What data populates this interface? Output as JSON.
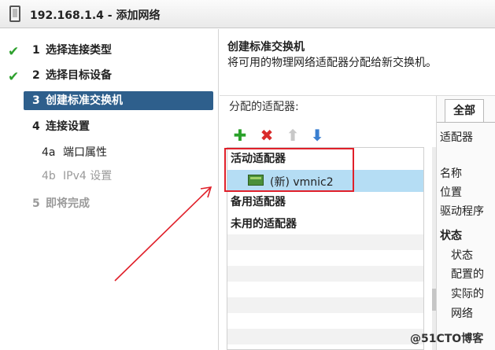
{
  "window": {
    "title": "192.168.1.4 - 添加网络"
  },
  "steps": [
    {
      "num": "1",
      "label": "选择连接类型"
    },
    {
      "num": "2",
      "label": "选择目标设备"
    },
    {
      "num": "3",
      "label": "创建标准交换机"
    },
    {
      "num": "4",
      "label": "连接设置"
    },
    {
      "num": "4a",
      "label": "端口属性"
    },
    {
      "num": "4b",
      "label": "IPv4 设置"
    },
    {
      "num": "5",
      "label": "即将完成"
    }
  ],
  "main": {
    "title": "创建标准交换机",
    "description": "将可用的物理网络适配器分配给新交换机。",
    "assigned_label": "分配的适配器:",
    "groups": {
      "active": "活动适配器",
      "standby": "备用适配器",
      "unused": "未用的适配器"
    },
    "adapter": "(新) vmnic2"
  },
  "right_pane": {
    "tab": "全部",
    "adapter_label": "适配器",
    "name_label": "名称",
    "location_label": "位置",
    "driver_label": "驱动程序",
    "status_heading": "状态",
    "status_label": "状态",
    "configured_label": "配置的",
    "actual_label": "实际的",
    "network_label": "网络"
  },
  "watermark": "@51CTO博客",
  "colors": {
    "active_step": "#2e5f8c",
    "selection": "#b5ddf4",
    "annotation": "#e0202a",
    "check": "#2ea02e"
  }
}
